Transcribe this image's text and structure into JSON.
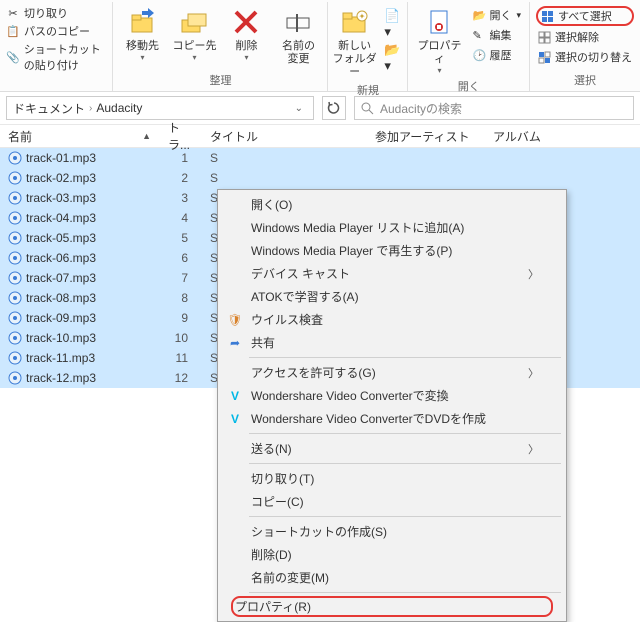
{
  "ribbon": {
    "left": {
      "cut": "切り取り",
      "copy_path": "パスのコピー",
      "paste_shortcut": "ショートカットの貼り付け"
    },
    "organize": {
      "move_to": "移動先",
      "copy_to": "コピー先",
      "delete": "削除",
      "rename": "名前の\n変更",
      "label": "整理"
    },
    "new": {
      "new_folder": "新しい\nフォルダー",
      "label": "新規"
    },
    "open": {
      "properties": "プロパティ",
      "open": "開く",
      "edit": "編集",
      "history": "履歴",
      "label": "開く"
    },
    "select": {
      "select_all": "すべて選択",
      "select_none": "選択解除",
      "invert": "選択の切り替え",
      "label": "選択"
    }
  },
  "breadcrumb": {
    "seg1": "ドキュメント",
    "seg2": "Audacity"
  },
  "search": {
    "placeholder": "Audacityの検索"
  },
  "columns": {
    "name": "名前",
    "track": "トラ...",
    "title": "タイトル",
    "artist": "参加アーティスト",
    "album": "アルバム"
  },
  "files": [
    {
      "name": "track-01.mp3",
      "track": "1",
      "title": "S"
    },
    {
      "name": "track-02.mp3",
      "track": "2",
      "title": "S"
    },
    {
      "name": "track-03.mp3",
      "track": "3",
      "title": "S"
    },
    {
      "name": "track-04.mp3",
      "track": "4",
      "title": "S"
    },
    {
      "name": "track-05.mp3",
      "track": "5",
      "title": "S"
    },
    {
      "name": "track-06.mp3",
      "track": "6",
      "title": "S"
    },
    {
      "name": "track-07.mp3",
      "track": "7",
      "title": "S"
    },
    {
      "name": "track-08.mp3",
      "track": "8",
      "title": "S"
    },
    {
      "name": "track-09.mp3",
      "track": "9",
      "title": "S"
    },
    {
      "name": "track-10.mp3",
      "track": "10",
      "title": "S"
    },
    {
      "name": "track-11.mp3",
      "track": "11",
      "title": "S"
    },
    {
      "name": "track-12.mp3",
      "track": "12",
      "title": "S"
    }
  ],
  "context_menu": {
    "open": "開く(O)",
    "wmp_add": "Windows Media Player リストに追加(A)",
    "wmp_play": "Windows Media Player で再生する(P)",
    "cast": "デバイス キャスト",
    "atok": "ATOKで学習する(A)",
    "virus": "ウイルス検査",
    "share": "共有",
    "access": "アクセスを許可する(G)",
    "ws_convert": "Wondershare Video Converterで変換",
    "ws_dvd": "Wondershare Video ConverterでDVDを作成",
    "send_to": "送る(N)",
    "cut": "切り取り(T)",
    "copy": "コピー(C)",
    "shortcut": "ショートカットの作成(S)",
    "delete": "削除(D)",
    "rename": "名前の変更(M)",
    "properties": "プロパティ(R)"
  }
}
